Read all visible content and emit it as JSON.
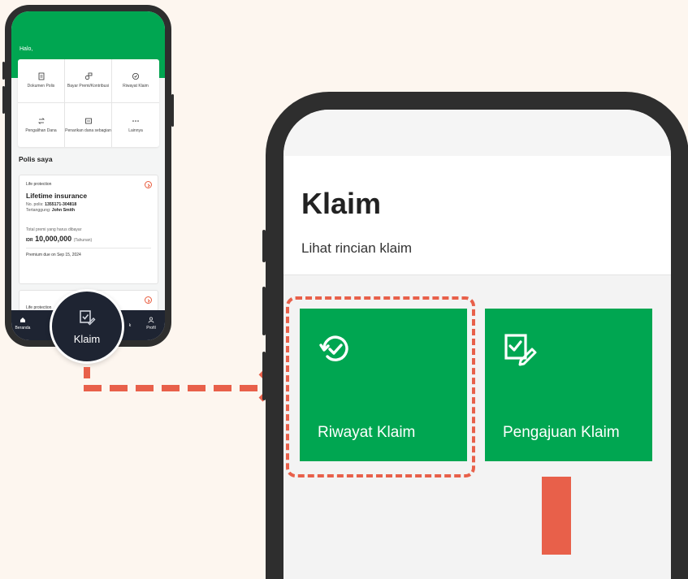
{
  "small_phone": {
    "greeting": "Halo,",
    "menu": [
      {
        "label": "Dokumen Polis",
        "icon": "document-icon"
      },
      {
        "label": "Bayar Premi/Kontribusi",
        "icon": "pay-icon"
      },
      {
        "label": "Riwayat Klaim",
        "icon": "history-icon"
      },
      {
        "label": "Pengalihan Dana",
        "icon": "transfer-icon"
      },
      {
        "label": "Penarikan dana sebagian",
        "icon": "withdraw-icon"
      },
      {
        "label": "Lainnya",
        "icon": "more-icon"
      }
    ],
    "section_title": "Polis saya",
    "policy_card": {
      "category": "Life protection",
      "name": "Lifetime insurance",
      "policy_no_label": "No. polis:",
      "policy_no": "1355171-304818",
      "insured_label": "Tertanggung:",
      "insured": "John Smith",
      "premium_label": "Total premi yang harus dibayar",
      "currency": "IDR",
      "amount": "10,000,000",
      "period": "(Tahunan)",
      "due": "Premium due on Sep 15, 2024"
    },
    "policy_card_2": {
      "category": "Life protection"
    },
    "nav": [
      {
        "label": "Beranda",
        "icon": "home-icon"
      },
      {
        "label": "Klaim",
        "icon": "claim-icon"
      },
      {
        "label": "Profil",
        "icon": "profile-icon"
      }
    ],
    "nav_partial": "k"
  },
  "bubble": {
    "label": "Klaim",
    "icon": "claim-icon"
  },
  "big_phone": {
    "title": "Klaim",
    "subtitle": "Lihat rincian klaim",
    "tiles": [
      {
        "label": "Riwayat Klaim",
        "icon": "history-check-icon"
      },
      {
        "label": "Pengajuan Klaim",
        "icon": "claim-submit-icon"
      }
    ]
  },
  "colors": {
    "brand_green": "#00a651",
    "accent_red": "#e8604a",
    "nav_dark": "#1e2432"
  }
}
